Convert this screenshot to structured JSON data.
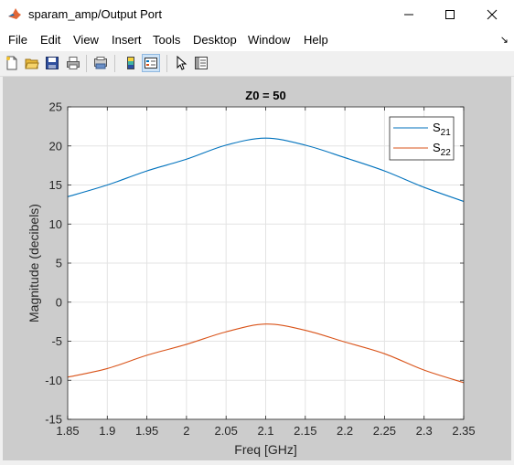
{
  "window": {
    "title": "sparam_amp/Output Port"
  },
  "menu": [
    "File",
    "Edit",
    "View",
    "Insert",
    "Tools",
    "Desktop",
    "Window",
    "Help"
  ],
  "toolbar": {
    "buttons": [
      "new-figure-icon",
      "open-file-icon",
      "save-icon",
      "print-icon",
      "print-preview-icon",
      "colorbar-icon",
      "legend-icon",
      "pointer-icon",
      "property-inspector-icon"
    ]
  },
  "chart_data": {
    "type": "line",
    "title": "Z0 = 50",
    "xlabel": "Freq [GHz]",
    "ylabel": "Magnitude (decibels)",
    "xlim": [
      1.85,
      2.35
    ],
    "ylim": [
      -15,
      25
    ],
    "xticks": [
      "1.85",
      "1.9",
      "1.95",
      "2",
      "2.05",
      "2.1",
      "2.15",
      "2.2",
      "2.25",
      "2.3",
      "2.35"
    ],
    "yticks": [
      "25",
      "20",
      "15",
      "10",
      "5",
      "0",
      "-5",
      "-10",
      "-15"
    ],
    "grid": true,
    "legend_position": "top-right",
    "series": [
      {
        "name": "S21",
        "legend_main": "S",
        "legend_sub": "21",
        "color": "#0072bd",
        "points": [
          [
            1.85,
            13.5
          ],
          [
            1.9,
            15.0
          ],
          [
            1.95,
            16.8
          ],
          [
            2.0,
            18.3
          ],
          [
            2.05,
            20.1
          ],
          [
            2.1,
            21.0
          ],
          [
            2.15,
            20.1
          ],
          [
            2.2,
            18.5
          ],
          [
            2.25,
            16.8
          ],
          [
            2.3,
            14.7
          ],
          [
            2.35,
            12.9
          ]
        ]
      },
      {
        "name": "S22",
        "legend_main": "S",
        "legend_sub": "22",
        "color": "#d95319",
        "points": [
          [
            1.85,
            -9.6
          ],
          [
            1.9,
            -8.5
          ],
          [
            1.95,
            -6.8
          ],
          [
            2.0,
            -5.4
          ],
          [
            2.05,
            -3.8
          ],
          [
            2.1,
            -2.8
          ],
          [
            2.15,
            -3.6
          ],
          [
            2.2,
            -5.1
          ],
          [
            2.25,
            -6.6
          ],
          [
            2.3,
            -8.7
          ],
          [
            2.35,
            -10.3
          ]
        ]
      }
    ]
  }
}
